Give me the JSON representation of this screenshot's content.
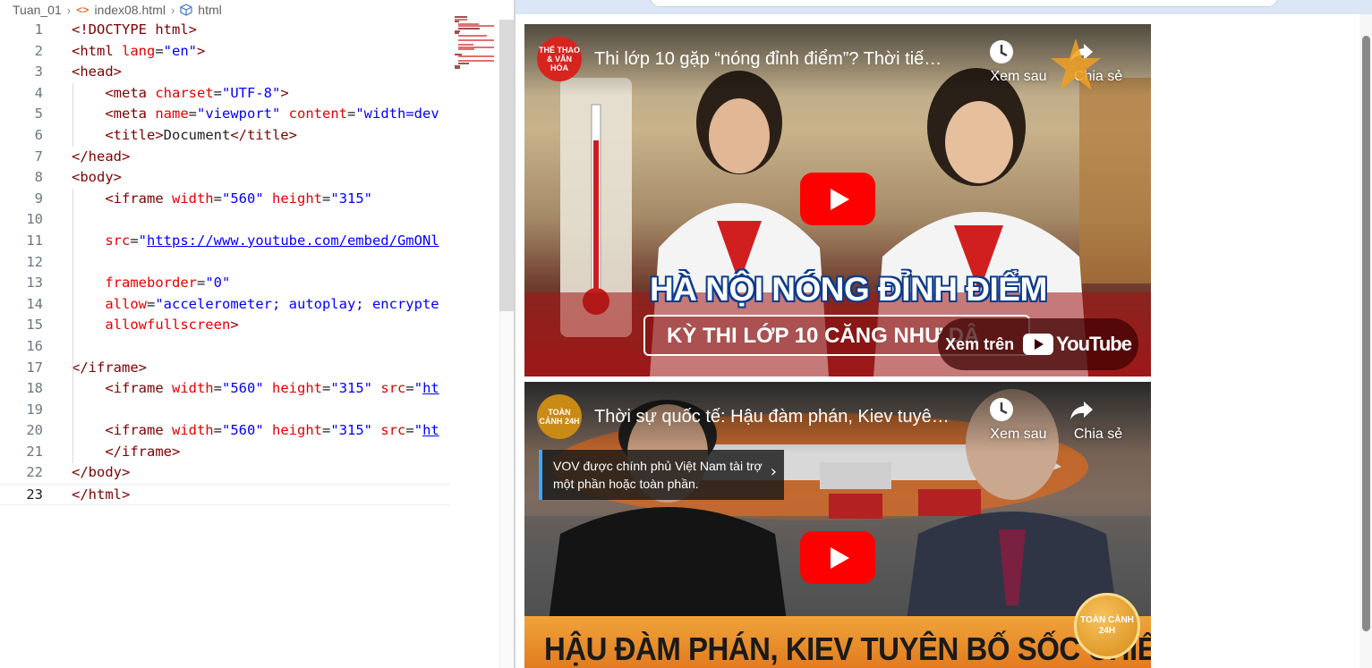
{
  "breadcrumb": {
    "folder": "Tuan_01",
    "file": "index08.html",
    "symbol": "html",
    "file_icon": "code-angle-icon",
    "symbol_icon": "cube-icon"
  },
  "editor": {
    "current_line": 23,
    "lines": [
      {
        "n": "1",
        "tokens": [
          [
            "tag",
            "<!DOCTYPE html>"
          ]
        ]
      },
      {
        "n": "2",
        "tokens": [
          [
            "tag",
            "<html "
          ],
          [
            "attr",
            "lang"
          ],
          [
            "txt",
            "="
          ],
          [
            "str",
            "\"en\""
          ],
          [
            "tag",
            ">"
          ]
        ]
      },
      {
        "n": "3",
        "tokens": [
          [
            "tag",
            "<head>"
          ]
        ]
      },
      {
        "n": "4",
        "tokens": [
          [
            "txt",
            "    "
          ],
          [
            "tag",
            "<meta "
          ],
          [
            "attr",
            "charset"
          ],
          [
            "txt",
            "="
          ],
          [
            "str",
            "\"UTF-8\""
          ],
          [
            "tag",
            ">"
          ]
        ]
      },
      {
        "n": "5",
        "tokens": [
          [
            "txt",
            "    "
          ],
          [
            "tag",
            "<meta "
          ],
          [
            "attr",
            "name"
          ],
          [
            "txt",
            "="
          ],
          [
            "str",
            "\"viewport\""
          ],
          [
            "txt",
            " "
          ],
          [
            "attr",
            "content"
          ],
          [
            "txt",
            "="
          ],
          [
            "str",
            "\"width=dev"
          ]
        ]
      },
      {
        "n": "6",
        "tokens": [
          [
            "txt",
            "    "
          ],
          [
            "tag",
            "<title>"
          ],
          [
            "txt",
            "Document"
          ],
          [
            "tag",
            "</title>"
          ]
        ]
      },
      {
        "n": "7",
        "tokens": [
          [
            "tag",
            "</head>"
          ]
        ]
      },
      {
        "n": "8",
        "tokens": [
          [
            "tag",
            "<body>"
          ]
        ]
      },
      {
        "n": "9",
        "tokens": [
          [
            "txt",
            "    "
          ],
          [
            "tag",
            "<iframe "
          ],
          [
            "attr",
            "width"
          ],
          [
            "txt",
            "="
          ],
          [
            "str",
            "\"560\""
          ],
          [
            "txt",
            " "
          ],
          [
            "attr",
            "height"
          ],
          [
            "txt",
            "="
          ],
          [
            "str",
            "\"315\""
          ]
        ]
      },
      {
        "n": "10",
        "tokens": []
      },
      {
        "n": "11",
        "tokens": [
          [
            "txt",
            "    "
          ],
          [
            "attr",
            "src"
          ],
          [
            "txt",
            "="
          ],
          [
            "str",
            "\""
          ],
          [
            "lnk",
            "https://www.youtube.com/embed/GmONl"
          ]
        ]
      },
      {
        "n": "12",
        "tokens": []
      },
      {
        "n": "13",
        "tokens": [
          [
            "txt",
            "    "
          ],
          [
            "attr",
            "frameborder"
          ],
          [
            "txt",
            "="
          ],
          [
            "str",
            "\"0\""
          ]
        ]
      },
      {
        "n": "14",
        "tokens": [
          [
            "txt",
            "    "
          ],
          [
            "attr",
            "allow"
          ],
          [
            "txt",
            "="
          ],
          [
            "str",
            "\"accelerometer; autoplay; encrypte"
          ]
        ]
      },
      {
        "n": "15",
        "tokens": [
          [
            "txt",
            "    "
          ],
          [
            "attr",
            "allowfullscreen"
          ],
          [
            "tag",
            ">"
          ]
        ]
      },
      {
        "n": "16",
        "tokens": []
      },
      {
        "n": "17",
        "tokens": [
          [
            "tag",
            "</iframe>"
          ]
        ]
      },
      {
        "n": "18",
        "tokens": [
          [
            "txt",
            "    "
          ],
          [
            "tag",
            "<iframe "
          ],
          [
            "attr",
            "width"
          ],
          [
            "txt",
            "="
          ],
          [
            "str",
            "\"560\""
          ],
          [
            "txt",
            " "
          ],
          [
            "attr",
            "height"
          ],
          [
            "txt",
            "="
          ],
          [
            "str",
            "\"315\""
          ],
          [
            "txt",
            " "
          ],
          [
            "attr",
            "src"
          ],
          [
            "txt",
            "="
          ],
          [
            "str",
            "\""
          ],
          [
            "lnk",
            "ht"
          ]
        ]
      },
      {
        "n": "19",
        "tokens": []
      },
      {
        "n": "20",
        "tokens": [
          [
            "txt",
            "    "
          ],
          [
            "tag",
            "<iframe "
          ],
          [
            "attr",
            "width"
          ],
          [
            "txt",
            "="
          ],
          [
            "str",
            "\"560\""
          ],
          [
            "txt",
            " "
          ],
          [
            "attr",
            "height"
          ],
          [
            "txt",
            "="
          ],
          [
            "str",
            "\"315\""
          ],
          [
            "txt",
            " "
          ],
          [
            "attr",
            "src"
          ],
          [
            "txt",
            "="
          ],
          [
            "str",
            "\""
          ],
          [
            "lnk",
            "ht"
          ]
        ]
      },
      {
        "n": "21",
        "tokens": [
          [
            "txt",
            "    "
          ],
          [
            "tag",
            "</iframe>"
          ]
        ]
      },
      {
        "n": "22",
        "tokens": [
          [
            "tag",
            "</body>"
          ]
        ]
      },
      {
        "n": "23",
        "tokens": [
          [
            "tag",
            "</html>"
          ]
        ]
      }
    ]
  },
  "videos": [
    {
      "channel_badge": "THỂ THAO & VĂN HÓA",
      "channel_color": "#d7241f",
      "title": "Thi lớp 10 gặp “nóng đỉnh điểm”? Thời tiế…",
      "watch_later": "Xem sau",
      "share": "Chia sẻ",
      "headline": "HÀ NỘI NÓNG ĐỈNH ĐIỂM",
      "subheadline": "KỲ THI LỚP 10 CĂNG NHƯ DÂ",
      "watch_on": "Xem trên",
      "youtube": "YouTube"
    },
    {
      "channel_badge": "TOÀN CẢNH 24H",
      "channel_color": "#c98a16",
      "title": "Thời sự quốc tế: Hậu đàm phán, Kiev tuyê…",
      "watch_later": "Xem sau",
      "share": "Chia sẻ",
      "funding_notice": "VOV được chính phủ Việt Nam tài trợ một phần hoặc toàn phần.",
      "headline": "HẬU ĐÀM PHÁN, KIEV TUYÊN BỐ SỐC CHIẾN DỊCH",
      "corner_logo": "TOÀN CẢNH 24H"
    }
  ],
  "colors": {
    "youtube_red": "#ff0000",
    "editor_tag": "#800000",
    "editor_attr": "#e50000",
    "editor_string": "#0000ff"
  }
}
